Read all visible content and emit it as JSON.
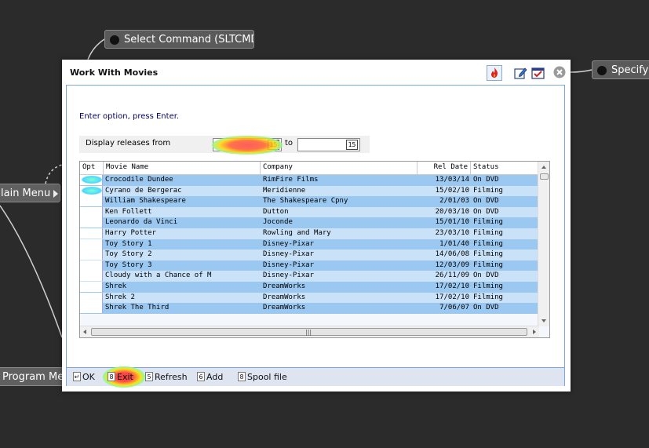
{
  "flow_nodes": {
    "select_command": "Select Command (SLTCMD)",
    "specify": "Specify V",
    "main_menu": "lain Menu",
    "program_messages": "Program Mes"
  },
  "dialog": {
    "title": "Work With Movies",
    "instruction": "Enter option, press Enter.",
    "filter": {
      "label": "Display releases from",
      "from_calendar": "15",
      "to_label": "to",
      "to_calendar": "15"
    },
    "columns": [
      "Opt",
      "Movie Name",
      "Company",
      "Rel Date",
      "Status"
    ],
    "rows": [
      {
        "opt": "",
        "name": "Crocodile Dundee",
        "company": "RimFire Films",
        "date": "13/03/14",
        "status": "On DVD"
      },
      {
        "opt": "",
        "name": "Cyrano de Bergerac",
        "company": "Meridienne",
        "date": "15/02/10",
        "status": "Filming"
      },
      {
        "opt": "",
        "name": "William Shakespeare",
        "company": "The Shakespeare Cpny",
        "date": "2/01/03",
        "status": "On DVD"
      },
      {
        "opt": "",
        "name": "Ken Follett",
        "company": "Dutton",
        "date": "20/03/10",
        "status": "On DVD"
      },
      {
        "opt": "",
        "name": "Leonardo da Vinci",
        "company": "Joconde",
        "date": "15/01/10",
        "status": "Filming"
      },
      {
        "opt": "",
        "name": "Harry Potter",
        "company": "Rowling and Mary",
        "date": "23/03/10",
        "status": "Filming"
      },
      {
        "opt": "",
        "name": "Toy Story 1",
        "company": "Disney-Pixar",
        "date": "1/01/40",
        "status": "Filming"
      },
      {
        "opt": "",
        "name": "Toy Story 2",
        "company": "Disney-Pixar",
        "date": "14/06/08",
        "status": "Filming"
      },
      {
        "opt": "",
        "name": "Toy Story 3",
        "company": "Disney-Pixar",
        "date": "12/03/09",
        "status": "Filming"
      },
      {
        "opt": "",
        "name": "Cloudy with a Chance of M",
        "company": "Disney-Pixar",
        "date": "26/11/09",
        "status": "On DVD"
      },
      {
        "opt": "",
        "name": "Shrek",
        "company": "DreamWorks",
        "date": "17/02/10",
        "status": "Filming"
      },
      {
        "opt": "",
        "name": "Shrek 2",
        "company": "DreamWorks",
        "date": "17/02/10",
        "status": "Filming"
      },
      {
        "opt": "",
        "name": "Shrek The Third",
        "company": "DreamWorks",
        "date": "7/06/07",
        "status": "On DVD"
      }
    ],
    "footer": {
      "ok": {
        "key": "↵",
        "label": "OK"
      },
      "exit": {
        "key": "8",
        "label": "Exit"
      },
      "refresh": {
        "key": "5",
        "label": "Refresh"
      },
      "add": {
        "key": "6",
        "label": "Add"
      },
      "spool": {
        "key": "8",
        "label": "Spool file"
      }
    }
  },
  "icons": [
    "flame-icon",
    "edit-icon",
    "checklist-icon",
    "close-icon"
  ],
  "colors": {
    "background": "#2b2b2b",
    "row_odd": "#9bc8f0",
    "row_even": "#c9e2f8",
    "panel_border": "#7aa7d6"
  }
}
